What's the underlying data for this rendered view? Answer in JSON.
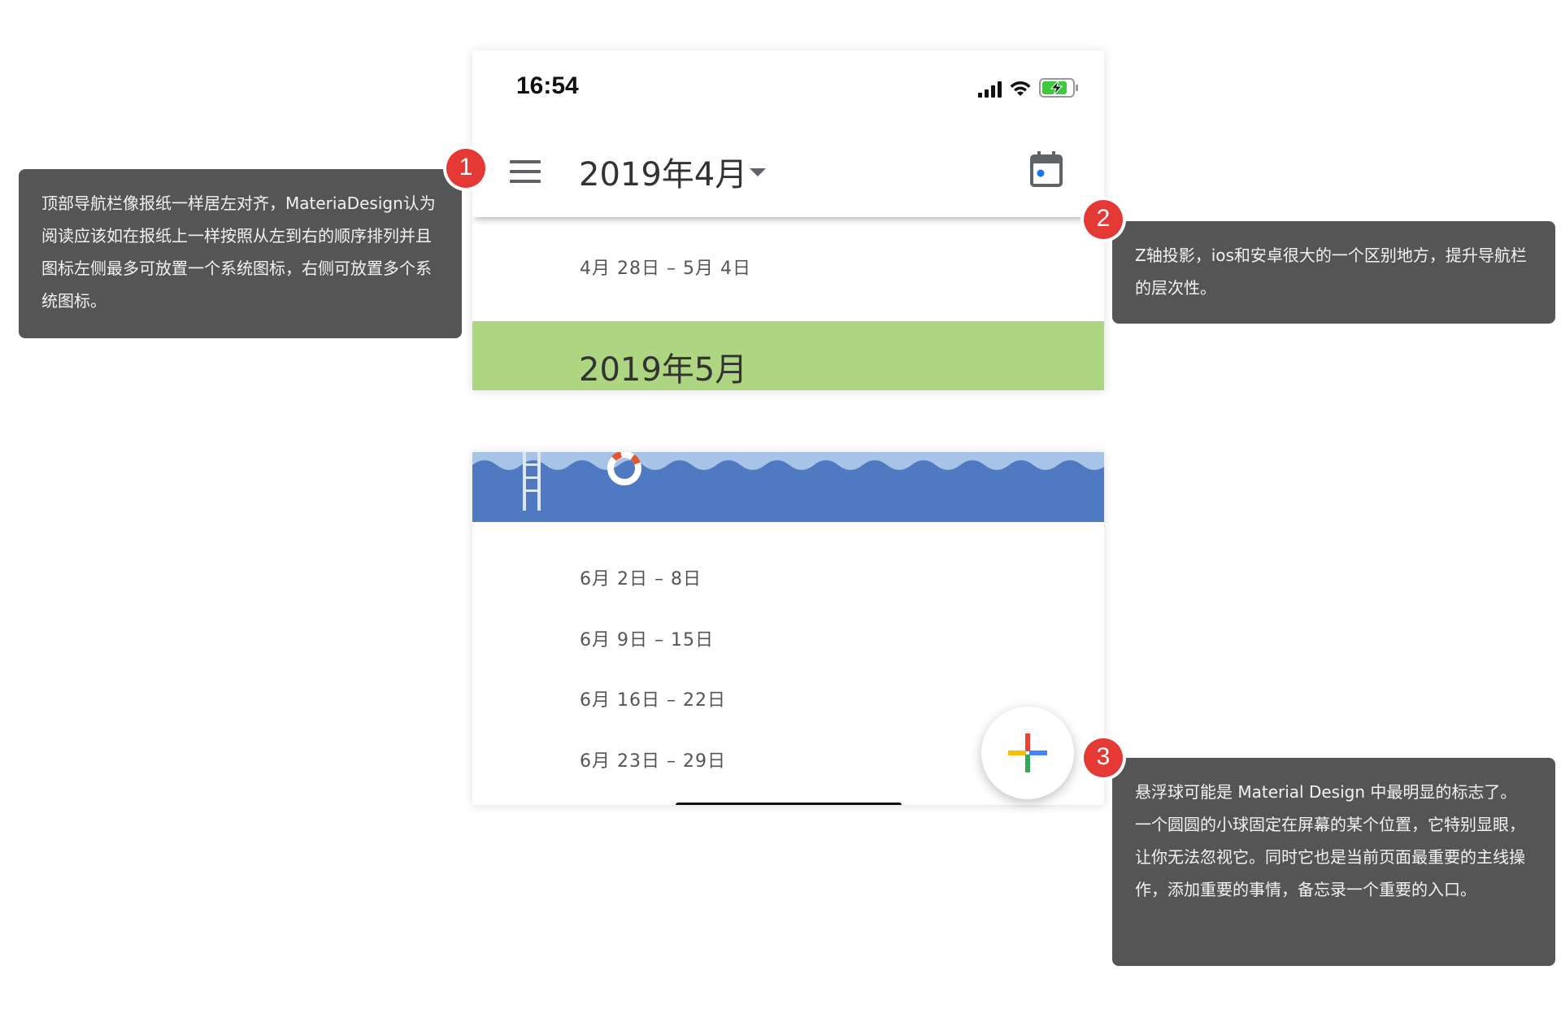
{
  "status_bar": {
    "time": "16:54"
  },
  "app_bar": {
    "title": "2019年4月"
  },
  "weeks_top": [
    "4月 28日 – 5月 4日"
  ],
  "may_banner": {
    "title": "2019年5月",
    "color": "#aed581"
  },
  "weeks_bottom": [
    "6月 2日 – 8日",
    "6月 9日 – 15日",
    "6月 16日 – 22日",
    "6月 23日 – 29日"
  ],
  "annotations": [
    {
      "number": "1",
      "text": "顶部导航栏像报纸一样居左对齐，MateriaDesign认为阅读应该如在报纸上一样按照从左到右的顺序排列并且图标左侧最多可放置一个系统图标，右侧可放置多个系统图标。"
    },
    {
      "number": "2",
      "text": "Z轴投影，ios和安卓很大的一个区别地方，提升导航栏的层次性。"
    },
    {
      "number": "3",
      "text": "悬浮球可能是 Material Design 中最明显的标志了。一个圆圆的小球固定在屏幕的某个位置，它特别显眼，让你无法忽视它。同时它也是当前页面最重要的主线操作，添加重要的事情，备忘录一个重要的入口。"
    }
  ],
  "colors": {
    "badge": "#e53935",
    "callout": "#555555",
    "water": "#4f79c0",
    "battery": "#3ec93e"
  },
  "icons": [
    "menu-icon",
    "dropdown-arrow-icon",
    "calendar-icon",
    "signal-icon",
    "wifi-icon",
    "battery-charging-icon",
    "add-icon"
  ]
}
